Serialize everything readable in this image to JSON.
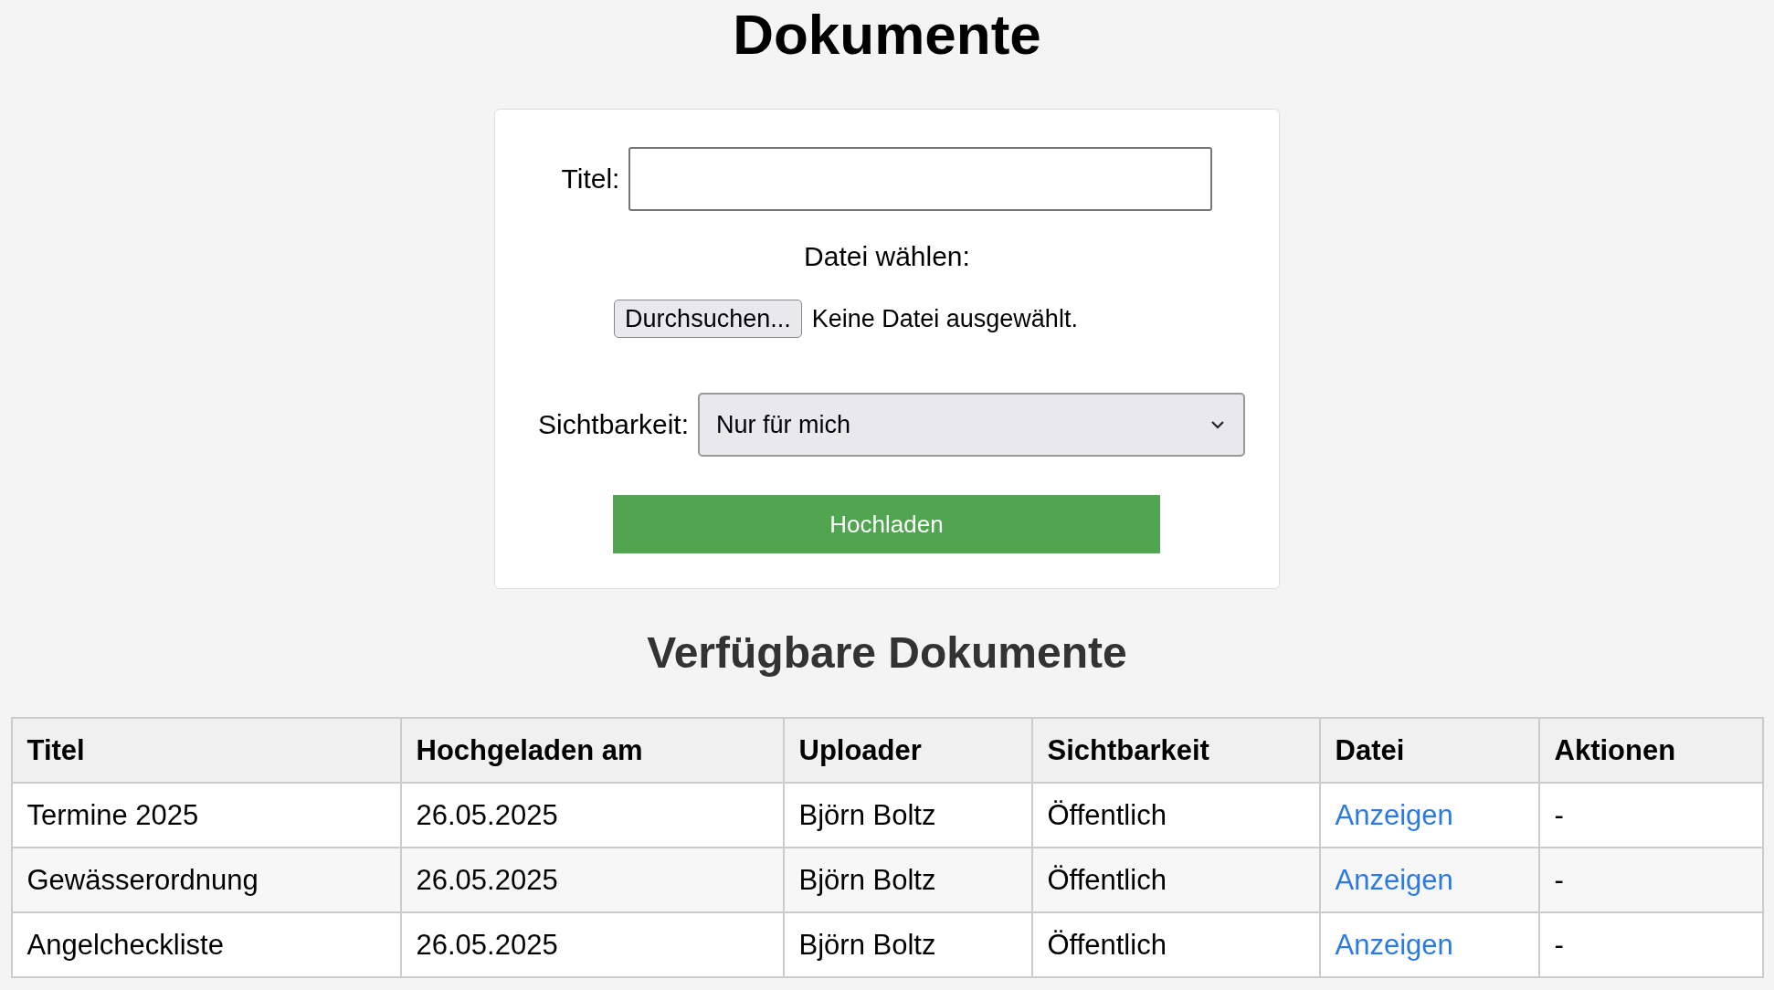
{
  "page_title": "Dokumente",
  "upload_form": {
    "title_label": "Titel:",
    "file_label": "Datei wählen:",
    "file_button": "Durchsuchen...",
    "file_status": "Keine Datei ausgewählt.",
    "visibility_label": "Sichtbarkeit:",
    "visibility_value": "Nur für mich",
    "submit": "Hochladen"
  },
  "list_title": "Verfügbare Dokumente",
  "table": {
    "columns": [
      "Titel",
      "Hochgeladen am",
      "Uploader",
      "Sichtbarkeit",
      "Datei",
      "Aktionen"
    ],
    "rows": [
      {
        "title": "Termine 2025",
        "date": "26.05.2025",
        "uploader": "Björn Boltz",
        "visibility": "Öffentlich",
        "file": "Anzeigen",
        "actions": "-"
      },
      {
        "title": "Gewässerordnung",
        "date": "26.05.2025",
        "uploader": "Björn Boltz",
        "visibility": "Öffentlich",
        "file": "Anzeigen",
        "actions": "-"
      },
      {
        "title": "Angelcheckliste",
        "date": "26.05.2025",
        "uploader": "Björn Boltz",
        "visibility": "Öffentlich",
        "file": "Anzeigen",
        "actions": "-"
      }
    ]
  }
}
